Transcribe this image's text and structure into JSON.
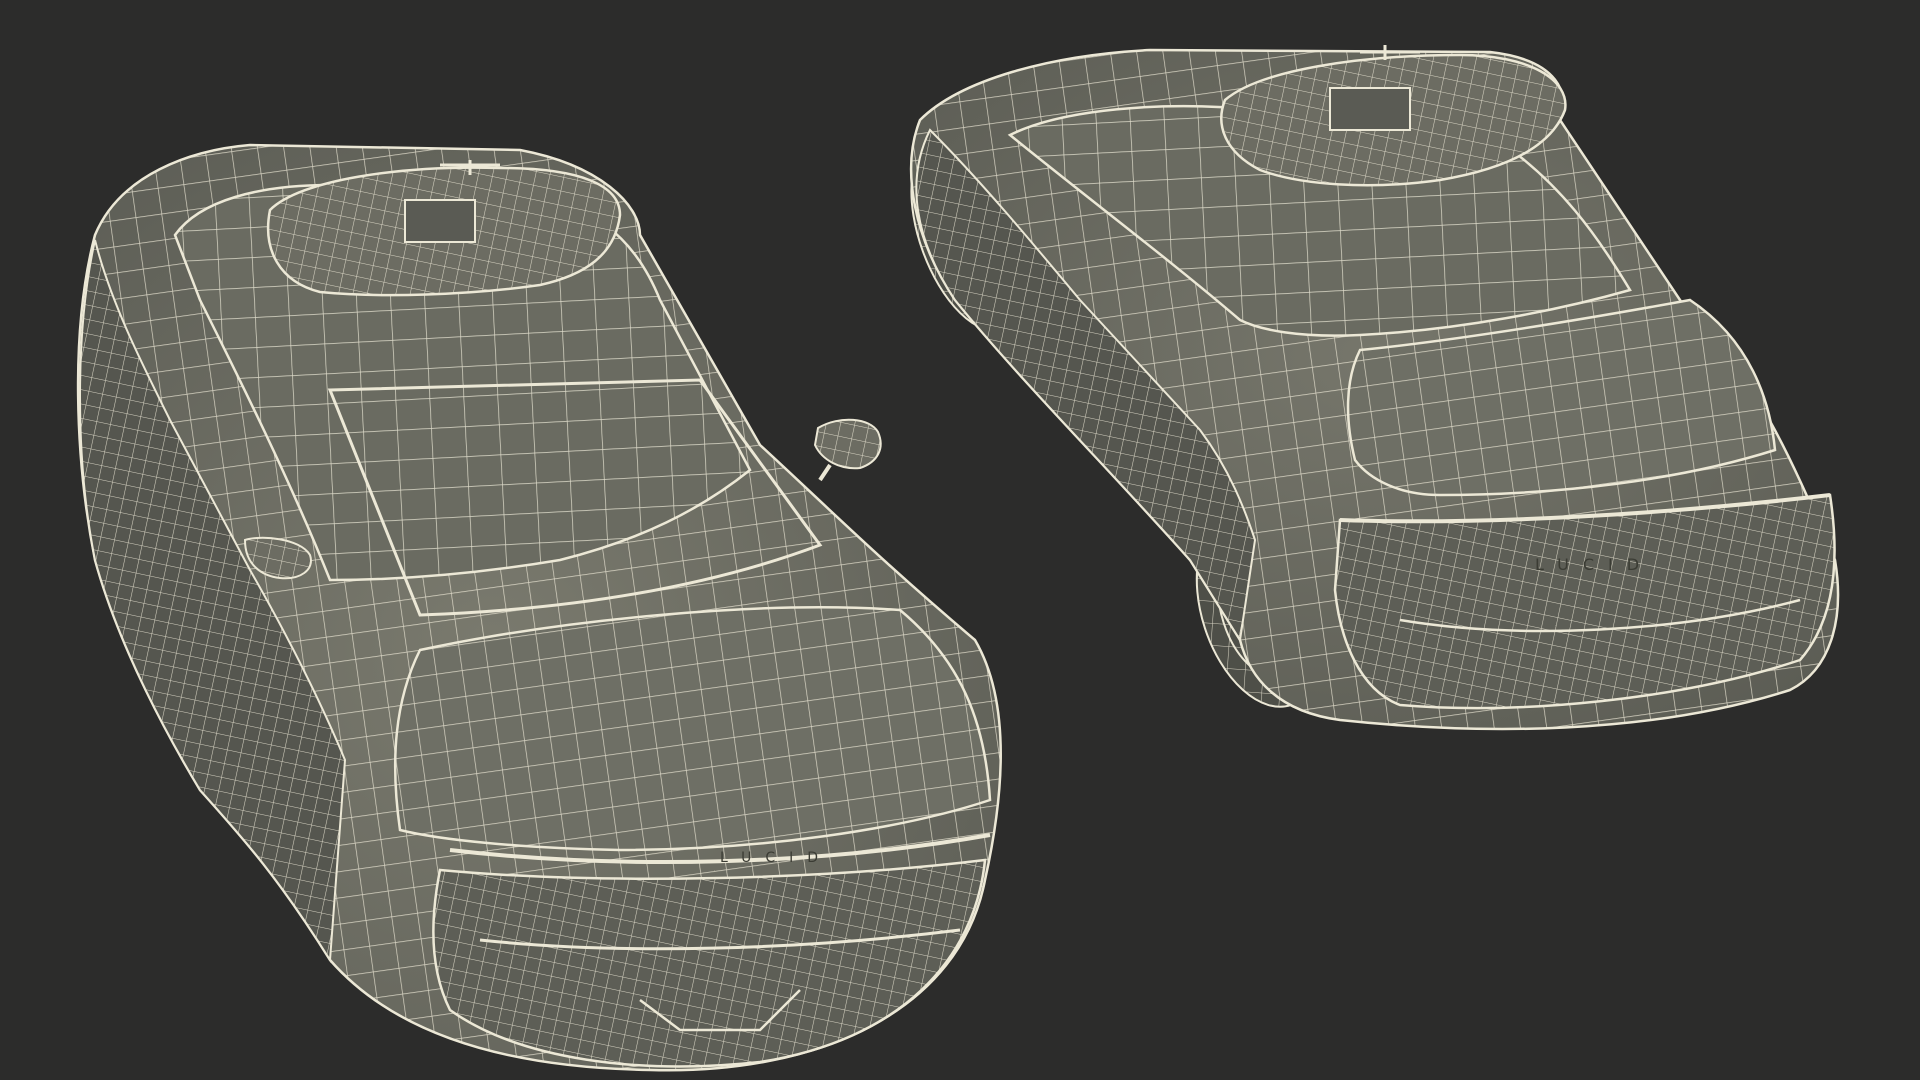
{
  "scene": {
    "background_color": "#2c2c2b",
    "wire_color": "#ece8d6",
    "surface_color": "#6c6c62",
    "surface_dark_color": "#4f5049",
    "models": [
      {
        "name": "car-front-view",
        "badge_text": "LUCID",
        "icon": "wireframe-car-icon"
      },
      {
        "name": "car-rear-view",
        "badge_text": "LUCID",
        "icon": "wireframe-car-icon"
      }
    ]
  }
}
